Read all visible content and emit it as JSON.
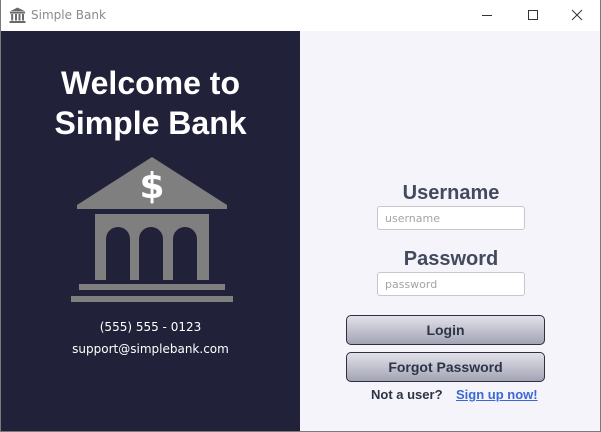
{
  "window": {
    "title": "Simple Bank",
    "icon": "bank-icon",
    "controls": [
      "minimize-icon",
      "maximize-icon",
      "close-icon"
    ]
  },
  "branding": {
    "welcome_line1": "Welcome to",
    "welcome_line2": "Simple Bank",
    "logo_icon": "bank-dollar-icon",
    "phone": "(555) 555 - 0123",
    "email": "support@simplebank.com"
  },
  "login_form": {
    "username_label": "Username",
    "username_placeholder": "username",
    "password_label": "Password",
    "password_placeholder": "password",
    "login_button": "Login",
    "forgot_button": "Forgot Password",
    "not_user_text": "Not a user?",
    "signup_link": "Sign up now!"
  },
  "colors": {
    "left_panel_bg": "#21223a",
    "right_panel_bg": "#f4f4fa",
    "label_text": "#434a5e",
    "link": "#3a68d4",
    "logo_gray": "#7f7f7f"
  }
}
